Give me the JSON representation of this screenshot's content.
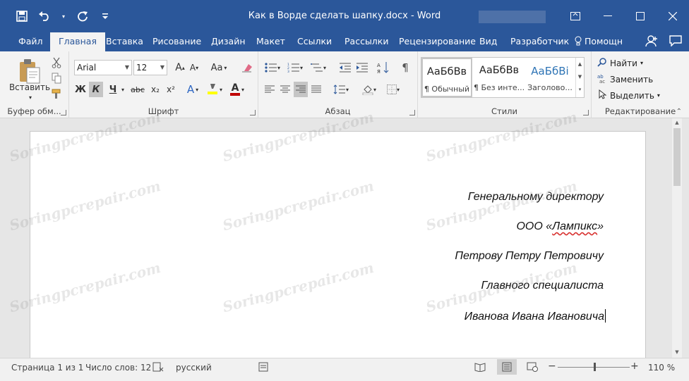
{
  "window": {
    "title": "Как в Ворде сделать шапку.docx  -  Word"
  },
  "ribbon_tabs": [
    "Файл",
    "Главная",
    "Вставка",
    "Рисование",
    "Дизайн",
    "Макет",
    "Ссылки",
    "Рассылки",
    "Рецензирование",
    "Вид",
    "Разработчик",
    "Помощн"
  ],
  "clipboard": {
    "paste_label": "Вставить",
    "group_label": "Буфер обм..."
  },
  "font": {
    "family": "Arial",
    "size": "12",
    "bold": "Ж",
    "italic": "К",
    "underline": "Ч",
    "strike": "abc",
    "subscript": "x₂",
    "superscript": "x²",
    "grow": "A",
    "shrink": "A",
    "case": "Aa",
    "effects": "A",
    "color": "A",
    "group_label": "Шрифт"
  },
  "paragraph": {
    "group_label": "Абзац"
  },
  "styles": {
    "items": [
      {
        "sample": "АаБбВв",
        "name": "¶ Обычный"
      },
      {
        "sample": "АаБбВв",
        "name": "¶ Без инте..."
      },
      {
        "sample": "АаБбВі",
        "name": "Заголово..."
      }
    ],
    "group_label": "Стили"
  },
  "editing": {
    "find": "Найти",
    "replace": "Заменить",
    "select": "Выделить",
    "group_label": "Редактирование"
  },
  "document": {
    "lines": [
      "Генеральному директору",
      "ООО «",
      "Лампикс",
      "»",
      "Петрову Петру Петровичу",
      "Главного специалиста",
      "Иванова Ивана Ивановича"
    ]
  },
  "statusbar": {
    "page": "Страница 1 из 1",
    "words": "Число слов: 12",
    "language": "русский",
    "zoom": "110 %",
    "zoom_minus": "−",
    "zoom_plus": "+",
    "zoom_level": 110
  },
  "watermark": "Soringpcrepair.com",
  "colors": {
    "titlebar": "#2b579a",
    "ribbon": "#f3f3f3",
    "highlight": "#ffff00",
    "font_color": "#c00000"
  }
}
